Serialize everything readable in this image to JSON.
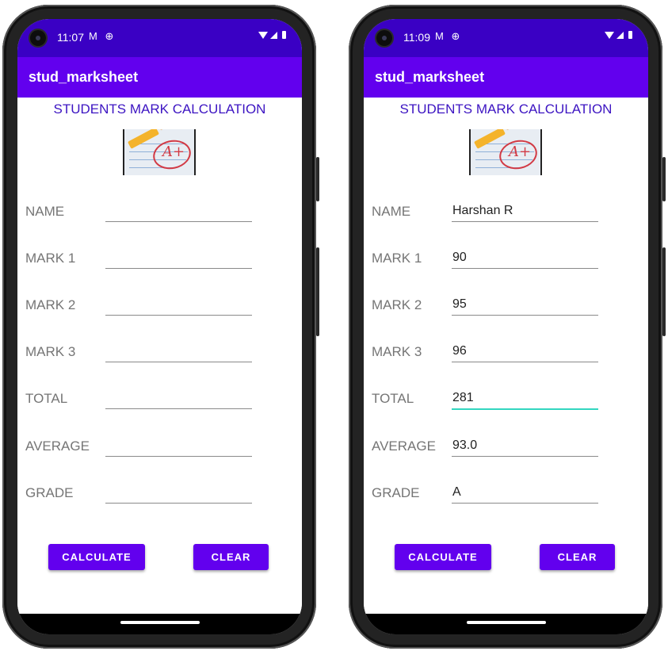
{
  "phones": [
    {
      "status": {
        "time": "11:07",
        "icons": "M ⊕"
      },
      "app": {
        "title": "stud_marksheet"
      },
      "heading": "STUDENTS MARK CALCULATION",
      "labels": {
        "name": "NAME",
        "mark1": "MARK 1",
        "mark2": "MARK 2",
        "mark3": "MARK 3",
        "total": "TOTAL",
        "average": "AVERAGE",
        "grade": "GRADE"
      },
      "fields": {
        "name": "",
        "mark1": "",
        "mark2": "",
        "mark3": "",
        "total": "",
        "average": "",
        "grade": ""
      },
      "buttons": {
        "calculate": "CALCULATE",
        "clear": "CLEAR"
      }
    },
    {
      "status": {
        "time": "11:09",
        "icons": "M ⊕"
      },
      "app": {
        "title": "stud_marksheet"
      },
      "heading": "STUDENTS MARK CALCULATION",
      "labels": {
        "name": "NAME",
        "mark1": "MARK 1",
        "mark2": "MARK 2",
        "mark3": "MARK 3",
        "total": "TOTAL",
        "average": "AVERAGE",
        "grade": "GRADE"
      },
      "fields": {
        "name": "Harshan R",
        "mark1": "90",
        "mark2": "95",
        "mark3": "96",
        "total": "281",
        "average": "93.0",
        "grade": "A"
      },
      "buttons": {
        "calculate": "CALCULATE",
        "clear": "CLEAR"
      }
    }
  ],
  "colors": {
    "status_bar": "#3a00c4",
    "app_bar": "#6200ee",
    "heading": "#3c14c2",
    "focus_underline": "#33d6c0"
  }
}
